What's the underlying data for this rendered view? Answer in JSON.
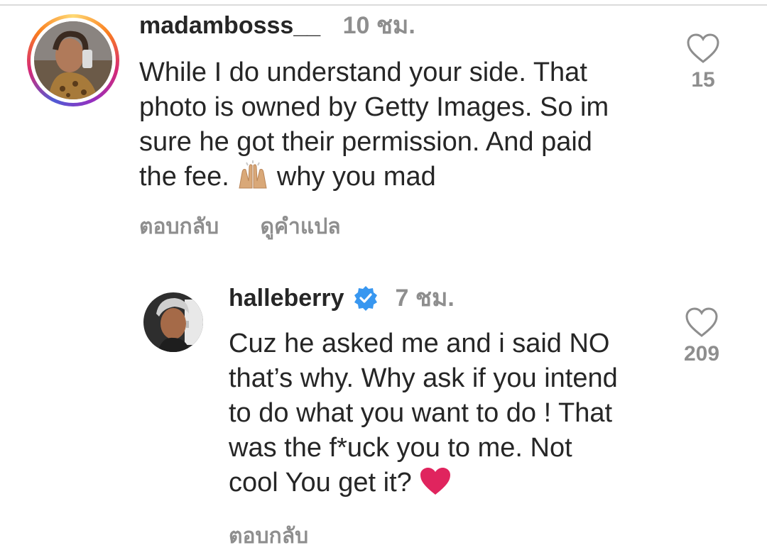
{
  "comments": [
    {
      "username": "madambosss__",
      "time": "10 ชม.",
      "text_lines": [
        "While I do understand your side.  That",
        "photo is owned by Getty Images. So im",
        "sure he got their permission. And paid",
        "the fee. ",
        "why you mad"
      ],
      "reply_label": "ตอบกลับ",
      "translate_label": "ดูคำแปล",
      "like_count": "15",
      "has_story_ring": true
    },
    {
      "username": "halleberry",
      "time": "7 ชม.",
      "verified": true,
      "text_lines": [
        "Cuz he asked me and i said NO",
        "that’s why. Why ask if you intend",
        "to do what you want to do ! That",
        "was the f*uck you to me. Not",
        "cool You get it? "
      ],
      "reply_label": "ตอบกลับ",
      "like_count": "209"
    }
  ],
  "icons": {
    "heart": "heart-outline-icon",
    "verified": "verified-badge-icon",
    "raised_hands": "raising-hands-emoji",
    "red_heart": "red-heart-emoji"
  },
  "colors": {
    "text": "#262626",
    "muted": "#8e8e8e",
    "verified_blue": "#3897f0",
    "heart_red": "#e0245e"
  }
}
